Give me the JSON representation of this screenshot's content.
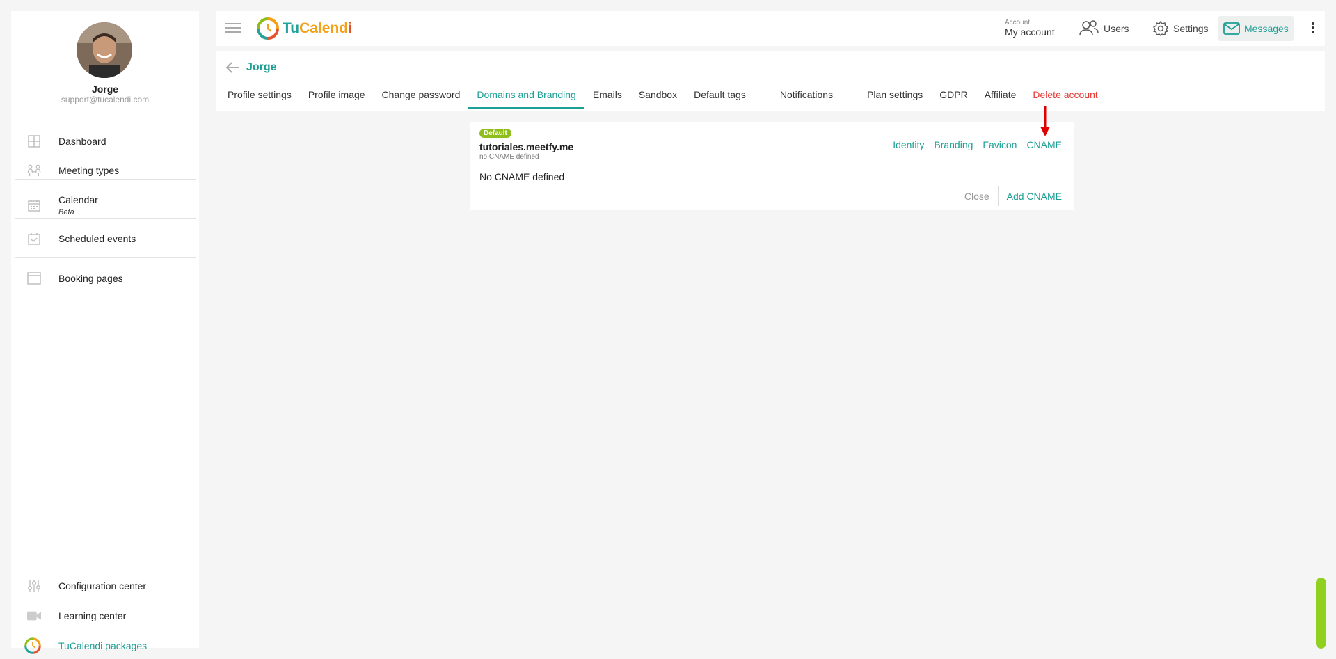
{
  "sidebar": {
    "user_name": "Jorge",
    "user_email": "support@tucalendi.com",
    "items": [
      {
        "label": "Dashboard",
        "icon": "dashboard-icon"
      },
      {
        "label": "Meeting types",
        "icon": "meeting-types-icon"
      },
      {
        "label": "Calendar",
        "sub": "Beta",
        "icon": "calendar-icon"
      },
      {
        "label": "Scheduled events",
        "icon": "scheduled-events-icon"
      },
      {
        "label": "Booking pages",
        "icon": "booking-pages-icon"
      }
    ],
    "bottom_items": [
      {
        "label": "Configuration center",
        "icon": "sliders-icon"
      },
      {
        "label": "Learning center",
        "icon": "video-icon"
      },
      {
        "label": "TuCalendi packages",
        "icon": "tucalendi-logo-icon"
      }
    ]
  },
  "topbar": {
    "logo": {
      "part1": "Tu",
      "part2": "Calend",
      "part3": "i"
    },
    "account_small": "Account",
    "account_big": "My account",
    "users_label": "Users",
    "settings_label": "Settings",
    "messages_label": "Messages"
  },
  "panel": {
    "back_name": "Jorge",
    "tabs": [
      "Profile settings",
      "Profile image",
      "Change password",
      "Domains and Branding",
      "Emails",
      "Sandbox",
      "Default tags",
      "Notifications",
      "Plan settings",
      "GDPR",
      "Affiliate",
      "Delete account"
    ],
    "active_tab": "Domains and Branding"
  },
  "card": {
    "badge": "Default",
    "domain": "tutoriales.meetfy.me",
    "domain_sub": "no CNAME defined",
    "links": [
      "Identity",
      "Branding",
      "Favicon",
      "CNAME"
    ],
    "message": "No CNAME defined",
    "close_label": "Close",
    "add_label": "Add CNAME"
  },
  "colors": {
    "accent": "#1c9f95",
    "danger": "#e53935",
    "badge": "#8fbd1c",
    "annotation_arrow": "#e00000"
  }
}
